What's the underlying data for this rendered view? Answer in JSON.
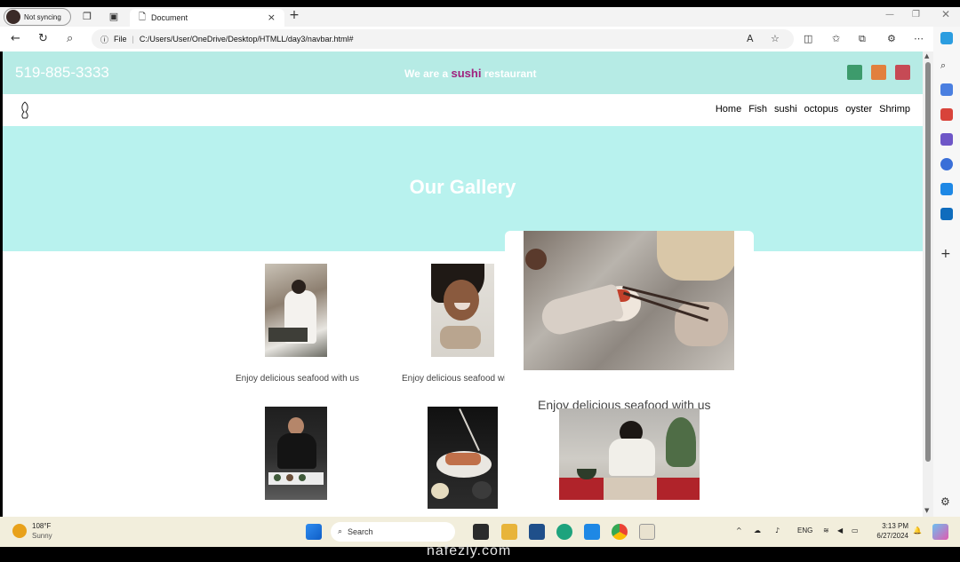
{
  "browser": {
    "profile_label": "Not syncing",
    "tab_title": "Document",
    "url_scheme": "File",
    "url": "C:/Users/User/OneDrive/Desktop/HTMLL/day3/navbar.html#"
  },
  "page": {
    "phone": "519-885-3333",
    "tagline_pre": "We are a",
    "tagline_highlight": "sushi",
    "tagline_post": "restaurant",
    "menu": [
      "Home",
      "Fish",
      "sushi",
      "octopus",
      "oyster",
      "Shrimp"
    ],
    "hero_title": "Our Gallery",
    "gallery": [
      {
        "caption": "Enjoy delicious seafood with us"
      },
      {
        "caption": "Enjoy delicious seafood with us"
      },
      {
        "caption": "Enjoy delicious seafood with us"
      }
    ]
  },
  "taskbar": {
    "temp": "108°F",
    "condition": "Sunny",
    "search_placeholder": "Search",
    "lang": "ENG",
    "time": "3:13 PM",
    "date": "6/27/2024"
  },
  "watermark": "nafezly.com",
  "colors": {
    "topbar": "#b6ebe5",
    "hero": "#b8f2ee",
    "highlight": "#a0217e"
  }
}
